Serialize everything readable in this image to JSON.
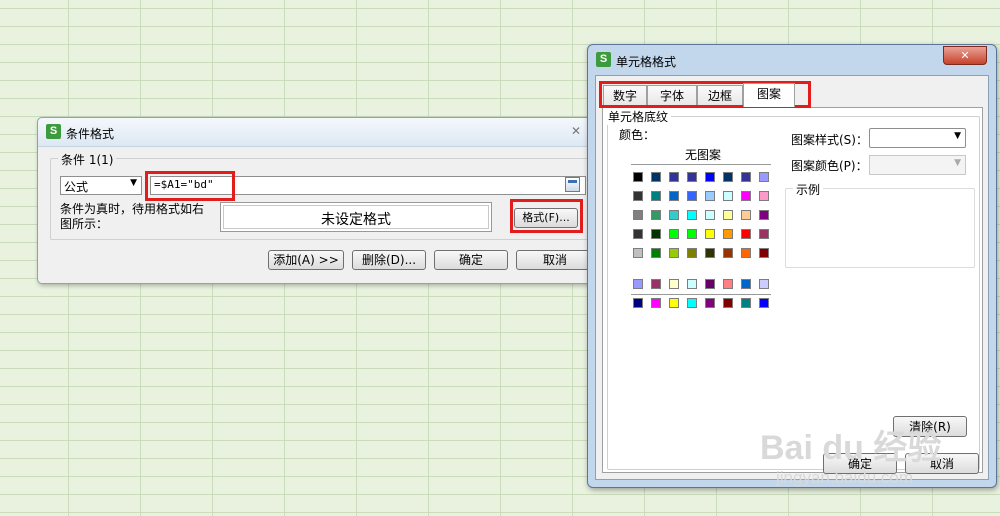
{
  "cond_dialog": {
    "title": "条件格式",
    "close_glyph": "✕",
    "group_label": "条件 1(1)",
    "type_value": "公式",
    "formula_value": "=$A1=\"bd\"",
    "preview_desc": "条件为真时，待用格式如右图所示：",
    "preview_text": "未设定格式",
    "format_button": "格式(F)...",
    "add_button": "添加(A) >>",
    "delete_button": "删除(D)...",
    "ok_button": "确定",
    "cancel_button": "取消"
  },
  "cell_dialog": {
    "title": "单元格格式",
    "close_glyph": "✕",
    "tabs": [
      "数字",
      "字体",
      "边框",
      "图案"
    ],
    "active_tab": "图案",
    "group_label": "单元格底纹",
    "color_label": "颜色：",
    "no_pattern": "无图案",
    "pattern_style_label": "图案样式(S)：",
    "pattern_color_label": "图案颜色(P)：",
    "sample_label": "示例",
    "clear_button": "清除(R)",
    "ok_button": "确定",
    "cancel_button": "取消",
    "palette": [
      [
        "#000000",
        "#003366",
        "#333399",
        "#333399",
        "#0000ff",
        "#003366",
        "#333399",
        "#9999ff"
      ],
      [
        "#333333",
        "#008080",
        "#0066cc",
        "#3366ff",
        "#99ccff",
        "#ccffff",
        "#ff00ff",
        "#ff99cc"
      ],
      [
        "#808080",
        "#339966",
        "#33cccc",
        "#00ffff",
        "#ccffff",
        "#ffff99",
        "#ffcc99",
        "#800080"
      ],
      [
        "#333333",
        "#003300",
        "#00ff00",
        "#00ff00",
        "#ffff00",
        "#ff9900",
        "#ff0000",
        "#993366"
      ],
      [
        "#c0c0c0",
        "#008000",
        "#99cc00",
        "#808000",
        "#333300",
        "#993300",
        "#ff6600",
        "#800000"
      ],
      [
        "#9999ff",
        "#993366",
        "#ffffcc",
        "#ccffff",
        "#660066",
        "#ff8080",
        "#0066cc",
        "#ccccff"
      ],
      [
        "#000080",
        "#ff00ff",
        "#ffff00",
        "#00ffff",
        "#800080",
        "#800000",
        "#008080",
        "#0000ff"
      ]
    ]
  },
  "watermark": {
    "brand": "Bai du 经验",
    "url": "jingyan.baidu.com"
  }
}
